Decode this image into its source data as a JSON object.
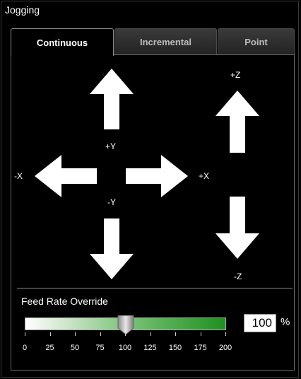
{
  "panel": {
    "title": "Jogging"
  },
  "tabs": [
    {
      "label": "Continuous",
      "active": true
    },
    {
      "label": "Incremental",
      "active": false
    },
    {
      "label": "Point",
      "active": false
    }
  ],
  "jog": {
    "plus_y": "+Y",
    "minus_y": "-Y",
    "plus_x": "+X",
    "minus_x": "-X",
    "plus_z": "+Z",
    "minus_z": "-Z"
  },
  "feed_rate": {
    "title": "Feed Rate Override",
    "value": "100",
    "unit": "%",
    "min": 0,
    "max": 200,
    "current": 100,
    "tick_labels": [
      "0",
      "25",
      "50",
      "75",
      "100",
      "125",
      "150",
      "175",
      "200"
    ]
  },
  "colors": {
    "background": "#000000",
    "slider_end": "#1f8f1f",
    "text": "#ffffff"
  }
}
